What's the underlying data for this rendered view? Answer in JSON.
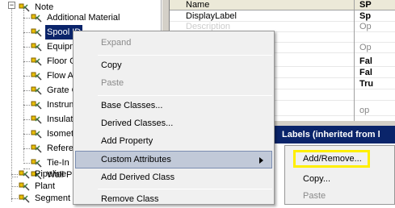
{
  "tree": {
    "items": [
      {
        "label": "Note"
      },
      {
        "label": "Additional Material"
      },
      {
        "label": "Spool ID"
      },
      {
        "label": "Equipm"
      },
      {
        "label": "Floor C"
      },
      {
        "label": "Flow A"
      },
      {
        "label": "Grate C"
      },
      {
        "label": "Instrum"
      },
      {
        "label": "Insulati"
      },
      {
        "label": "Isomet"
      },
      {
        "label": "Refere"
      },
      {
        "label": "Tie-In"
      },
      {
        "label": "Wall P"
      },
      {
        "label": "Pipeline"
      },
      {
        "label": "Plant"
      },
      {
        "label": "Segment"
      }
    ],
    "expander_minus": "−"
  },
  "grid": {
    "header": {
      "name": "Name",
      "value": "SP"
    },
    "rows": [
      {
        "name": "DisplayLabel",
        "value": "Sp",
        "muted": false
      },
      {
        "name": "Description",
        "value": "Op",
        "muted": true
      },
      {
        "name": "",
        "value": "",
        "muted": false
      },
      {
        "name": "",
        "value": "Op",
        "muted": true
      },
      {
        "name": "",
        "value": "Fal",
        "muted": false
      },
      {
        "name": "",
        "value": "Fal",
        "muted": false
      },
      {
        "name": "",
        "value": "Tru",
        "muted": false
      },
      {
        "name": "",
        "value": "",
        "muted": false
      },
      {
        "name": "",
        "value": "op",
        "muted": true
      }
    ]
  },
  "labels_bar": "Labels (inherited from l",
  "context_menu": {
    "items": [
      {
        "label": "Expand",
        "disabled": true
      },
      {
        "label": "Copy",
        "disabled": false
      },
      {
        "label": "Paste",
        "disabled": true
      },
      {
        "label": "Base Classes...",
        "disabled": false
      },
      {
        "label": "Derived Classes...",
        "disabled": false
      },
      {
        "label": "Add Property",
        "disabled": false
      },
      {
        "label": "Custom Attributes",
        "disabled": false,
        "hot": true,
        "submenu": true
      },
      {
        "label": "Add Derived Class",
        "disabled": false
      },
      {
        "label": "Remove Class",
        "disabled": false
      }
    ]
  },
  "submenu": {
    "items": [
      {
        "label": "Add/Remove...",
        "disabled": false
      },
      {
        "label": "Copy...",
        "disabled": false
      },
      {
        "label": "Paste",
        "disabled": true
      }
    ]
  },
  "colors": {
    "selection": "#0a246a",
    "menu_hot": "#c1c9d8",
    "callout": "#ffef00"
  }
}
